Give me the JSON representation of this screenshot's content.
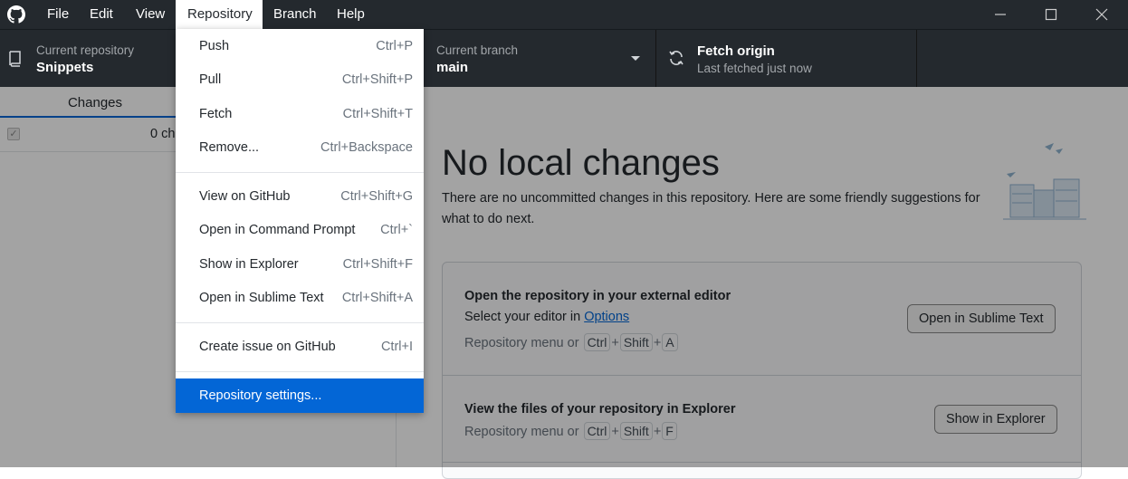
{
  "menubar": {
    "items": [
      "File",
      "Edit",
      "View",
      "Repository",
      "Branch",
      "Help"
    ],
    "active": "Repository"
  },
  "toolbar": {
    "repo_label": "Current repository",
    "repo_value": "Snippets",
    "branch_label": "Current branch",
    "branch_value": "main",
    "fetch_title": "Fetch origin",
    "fetch_sub": "Last fetched just now"
  },
  "left": {
    "tab_changes": "Changes",
    "changes_count": "0 ch"
  },
  "main": {
    "title": "No local changes",
    "description": "There are no uncommitted changes in this repository. Here are some friendly suggestions for what to do next.",
    "suggestions": [
      {
        "title": "Open the repository in your external editor",
        "subtitle_prefix": "Select your editor in ",
        "subtitle_link": "Options",
        "hint_prefix": "Repository menu or",
        "keys": [
          "Ctrl",
          "Shift",
          "A"
        ],
        "button": "Open in Sublime Text"
      },
      {
        "title": "View the files of your repository in Explorer",
        "hint_prefix": "Repository menu or",
        "keys": [
          "Ctrl",
          "Shift",
          "F"
        ],
        "button": "Show in Explorer"
      }
    ]
  },
  "dropdown": {
    "items": [
      {
        "label": "Push",
        "accel": "Ctrl+P"
      },
      {
        "label": "Pull",
        "accel": "Ctrl+Shift+P"
      },
      {
        "label": "Fetch",
        "accel": "Ctrl+Shift+T"
      },
      {
        "label": "Remove...",
        "accel": "Ctrl+Backspace"
      },
      {
        "label": "View on GitHub",
        "accel": "Ctrl+Shift+G"
      },
      {
        "label": "Open in Command Prompt",
        "accel": "Ctrl+`"
      },
      {
        "label": "Show in Explorer",
        "accel": "Ctrl+Shift+F"
      },
      {
        "label": "Open in Sublime Text",
        "accel": "Ctrl+Shift+A"
      },
      {
        "label": "Create issue on GitHub",
        "accel": "Ctrl+I"
      },
      {
        "label": "Repository settings...",
        "accel": ""
      }
    ],
    "highlighted": "Repository settings..."
  },
  "icons": {
    "app": "github-icon",
    "repo": "repo-icon",
    "branch_dropdown": "chevron-down-icon",
    "fetch": "sync-icon",
    "minimize": "minimize-icon",
    "maximize": "maximize-icon",
    "close": "close-icon"
  },
  "colors": {
    "titlebar": "#24292e",
    "accent": "#0366d6",
    "highlight": "#0366d6"
  }
}
